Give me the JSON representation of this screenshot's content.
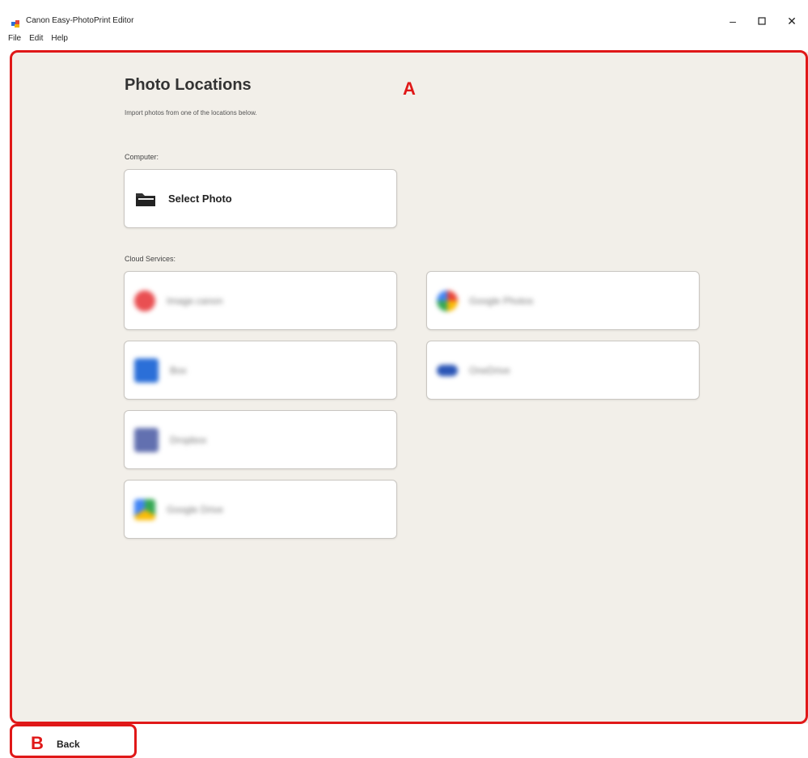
{
  "window": {
    "title": "Canon Easy-PhotoPrint Editor",
    "minimize": "–",
    "maximize": "☐",
    "close": "✕"
  },
  "menu": [
    "File",
    "Edit",
    "Help"
  ],
  "page": {
    "heading": "Photo Locations",
    "subheading": "Import photos from one of the locations below.",
    "computer_label": "Computer:",
    "select_photo": "Select Photo",
    "cloud_label": "Cloud Services:"
  },
  "cloud_services": [
    {
      "label": "Image.canon",
      "color": "#e94f52",
      "icon": "image-canon-icon"
    },
    {
      "label": "Google Photos",
      "color": "#f4b400",
      "icon": "google-photos-icon"
    },
    {
      "label": "Box",
      "color": "#2b6fd8",
      "icon": "box-icon"
    },
    {
      "label": "OneDrive",
      "color": "#2a55b6",
      "icon": "onedrive-icon"
    },
    {
      "label": "Dropbox",
      "color": "#6270b0",
      "icon": "dropbox-icon"
    },
    {
      "label": "Google Drive",
      "color": "#34a853",
      "icon": "google-drive-icon"
    }
  ],
  "annotations": {
    "a": "A",
    "b": "B"
  },
  "footer": {
    "back": "Back"
  },
  "colors": {
    "annotation": "#e01818",
    "content_bg": "#f2efe9"
  }
}
